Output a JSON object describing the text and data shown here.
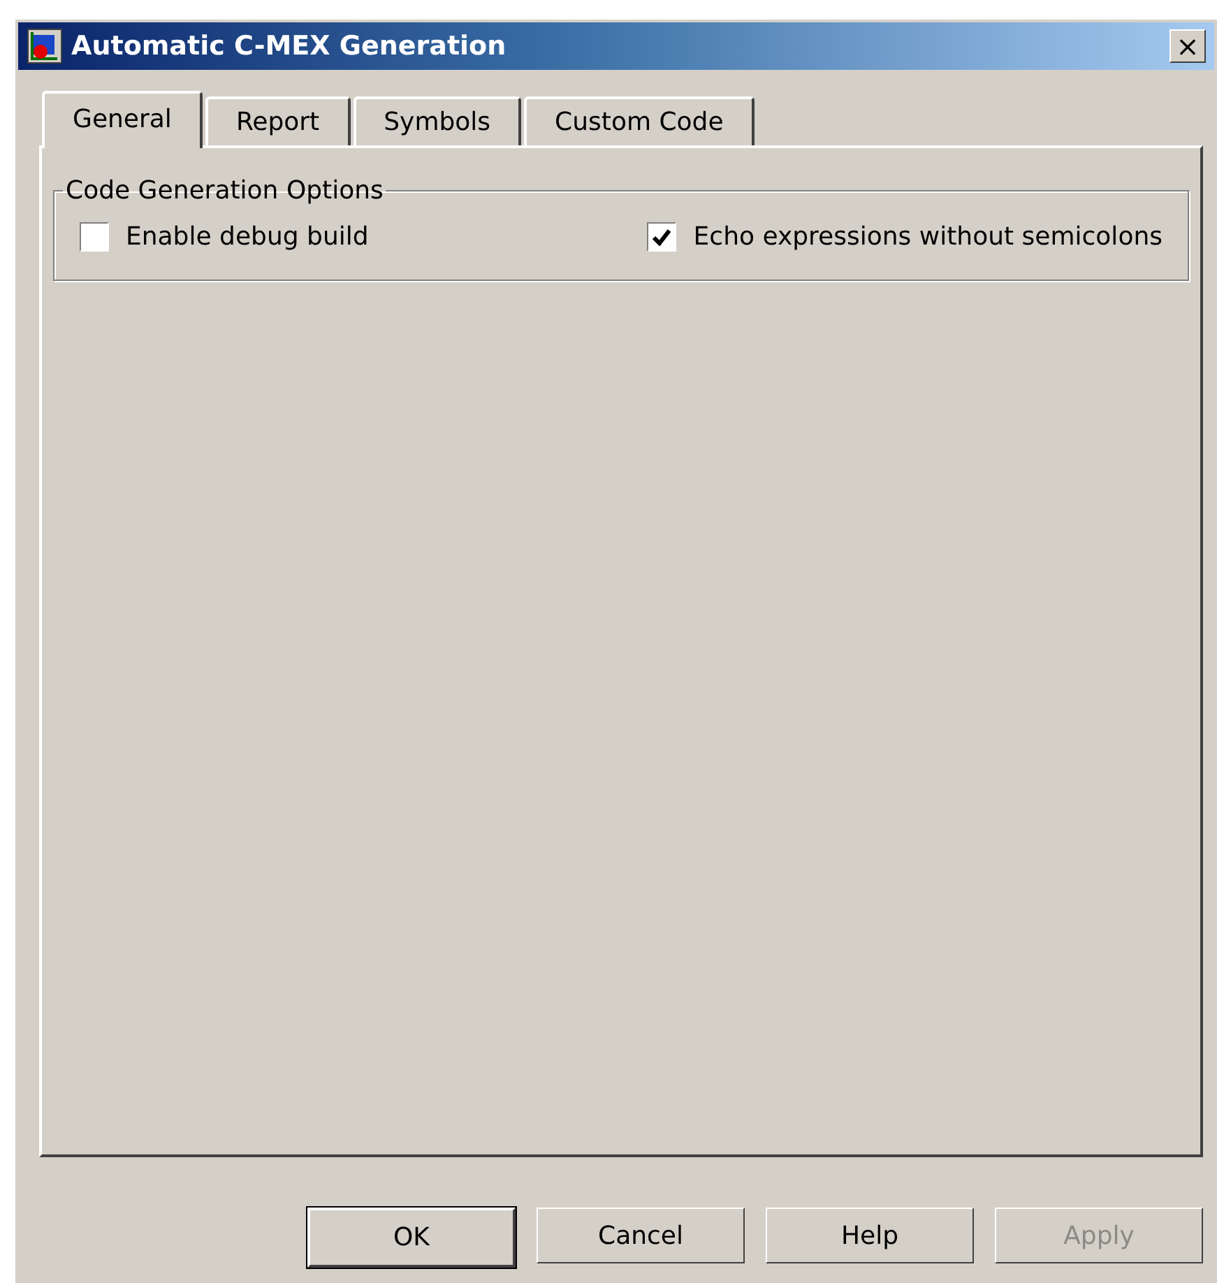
{
  "window": {
    "title": "Automatic C-MEX Generation",
    "close": "×"
  },
  "tabs": [
    {
      "label": "General",
      "selected": true
    },
    {
      "label": "Report",
      "selected": false
    },
    {
      "label": "Symbols",
      "selected": false
    },
    {
      "label": "Custom Code",
      "selected": false
    }
  ],
  "group": {
    "title": "Code Generation Options",
    "options": [
      {
        "label": "Enable debug build",
        "checked": false
      },
      {
        "label": "Echo expressions without semicolons",
        "checked": true
      }
    ]
  },
  "buttons": [
    {
      "label": "OK",
      "disabled": false,
      "default": true
    },
    {
      "label": "Cancel",
      "disabled": false,
      "default": false
    },
    {
      "label": "Help",
      "disabled": false,
      "default": false
    },
    {
      "label": "Apply",
      "disabled": true,
      "default": false
    }
  ]
}
